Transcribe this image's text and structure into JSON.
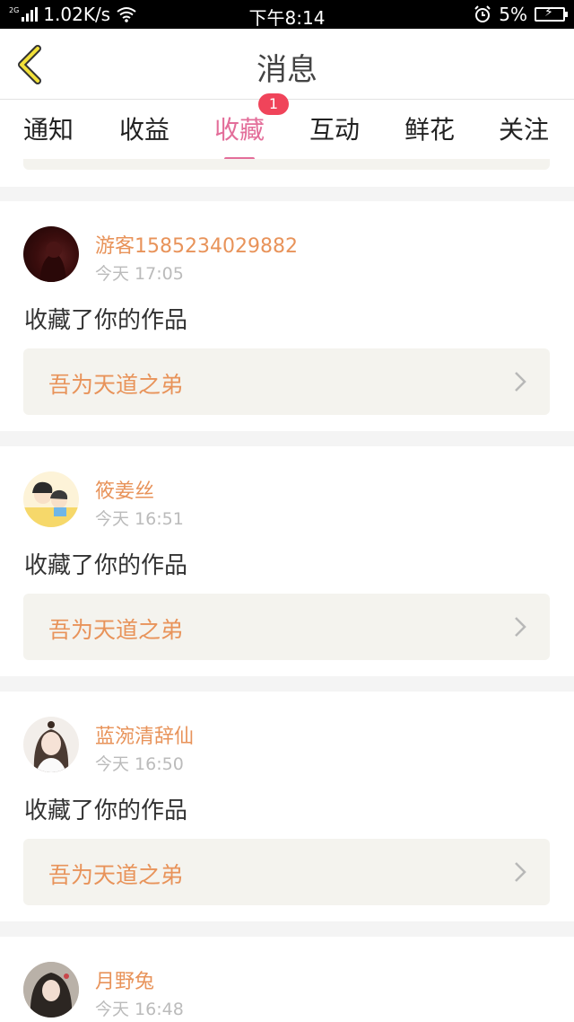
{
  "status_bar": {
    "network_type": "2G",
    "speed": "1.02K/s",
    "time": "下午8:14",
    "battery": "5%",
    "icons": [
      "signal-icon",
      "wifi-icon",
      "alarm-icon",
      "battery-charging-icon"
    ]
  },
  "header": {
    "title": "消息",
    "back_icon": "chevron-left-icon"
  },
  "tabs": [
    {
      "label": "通知"
    },
    {
      "label": "收益"
    },
    {
      "label": "收藏",
      "active": true
    },
    {
      "label": "互动"
    },
    {
      "label": "鲜花"
    },
    {
      "label": "关注"
    }
  ],
  "badge": "1",
  "colors": {
    "accent_pink": "#e36e9a",
    "username_orange": "#e8935a",
    "badge_red": "#f0445a",
    "work_bg": "#f4f3ee"
  },
  "messages": [
    {
      "username": "游客1585234029882",
      "time": "今天 17:05",
      "action": "收藏了你的作品",
      "work_title": "吾为天道之弟",
      "avatar": "dark-portrait-avatar"
    },
    {
      "username": "筱姜丝",
      "time": "今天 16:51",
      "action": "收藏了你的作品",
      "work_title": "吾为天道之弟",
      "avatar": "cartoon-couple-avatar"
    },
    {
      "username": "蓝涴清辞仙",
      "time": "今天 16:50",
      "action": "收藏了你的作品",
      "work_title": "吾为天道之弟",
      "avatar": "girl-portrait-avatar"
    },
    {
      "username": "月野兔",
      "time": "今天 16:48",
      "action": "",
      "work_title": "",
      "avatar": "anime-portrait-avatar"
    }
  ]
}
